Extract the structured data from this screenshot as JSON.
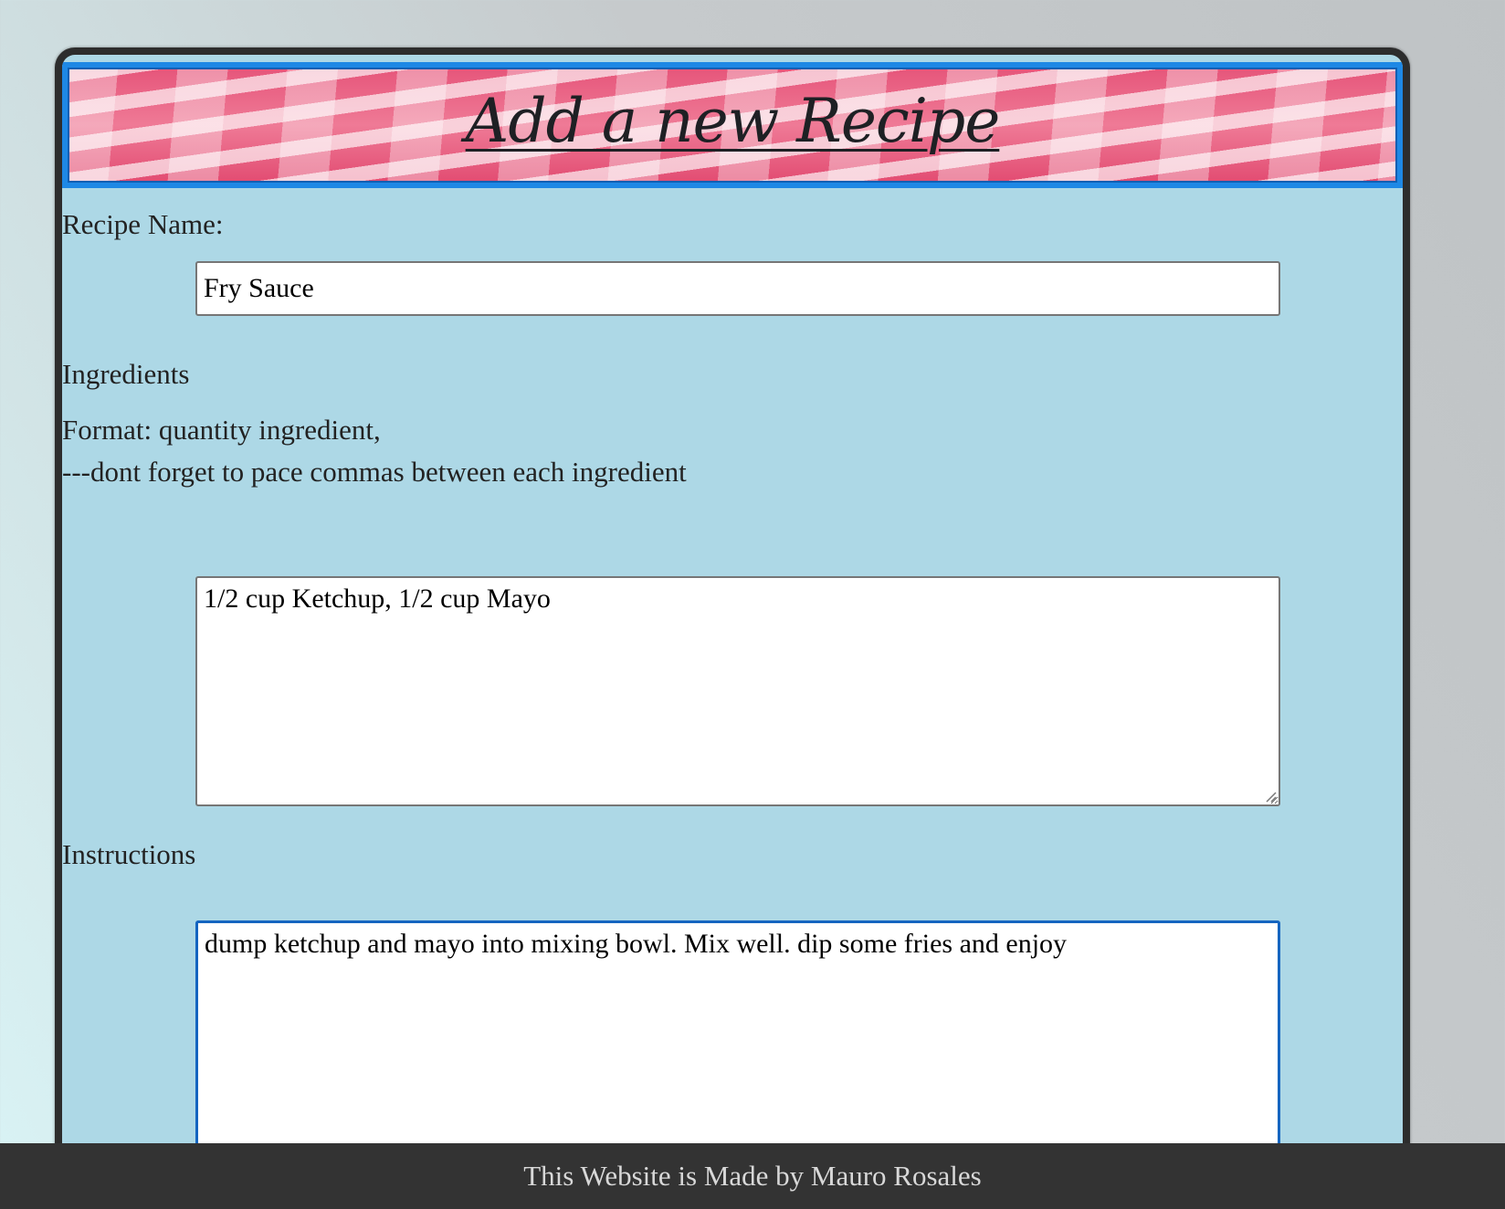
{
  "header": {
    "title": "Add a new Recipe"
  },
  "form": {
    "recipe_name_label": "Recipe Name:",
    "recipe_name_value": "Fry Sauce",
    "ingredients_label": "Ingredients",
    "format_line_1": "Format: quantity ingredient,",
    "format_line_2": "---dont forget to pace commas between each ingredient",
    "ingredients_value": "1/2 cup Ketchup, 1/2 cup Mayo",
    "instructions_label": "Instructions",
    "instructions_value": "dump ketchup and mayo into mixing bowl. Mix well. dip some fries and enjoy"
  },
  "footer": {
    "text": "This Website is Made by Mauro Rosales"
  },
  "colors": {
    "card_background": "#add8e6",
    "banner_border": "#1e88e5",
    "focus_border": "#1565c0",
    "footer_background": "#333333"
  }
}
